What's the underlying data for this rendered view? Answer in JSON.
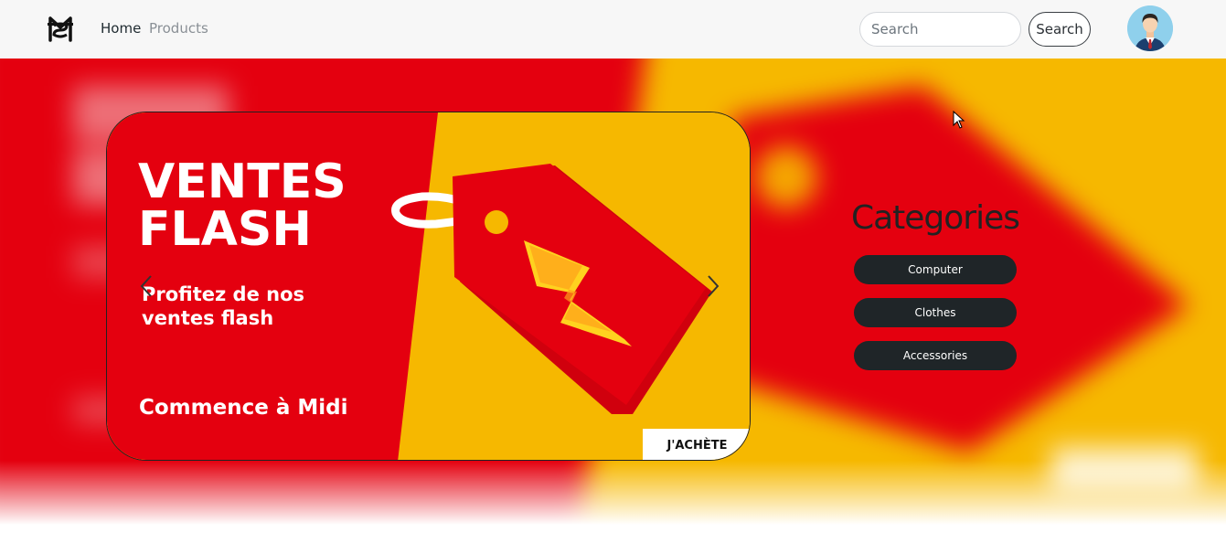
{
  "navbar": {
    "logo_icon": "monogram-logo-icon",
    "links": [
      {
        "label": "Home",
        "active": true
      },
      {
        "label": "Products",
        "active": false
      }
    ],
    "search": {
      "placeholder": "Search",
      "value": ""
    },
    "search_button_label": "Search",
    "avatar_icon": "user-avatar-icon"
  },
  "hero": {
    "slide": {
      "title_line1": "VENTES",
      "title_line2": "FLASH",
      "subtitle": "Profitez de nos ventes flash",
      "note": "Commence à Midi",
      "cta_label": "J'ACHÈTE",
      "prev_icon": "chevron-left-icon",
      "next_icon": "chevron-right-icon"
    }
  },
  "categories": {
    "title": "Categories",
    "items": [
      "Computer",
      "Clothes",
      "Accessories"
    ]
  },
  "colors": {
    "red": "#e4000f",
    "yellow": "#f6b800",
    "dark_button": "#1f2528"
  }
}
